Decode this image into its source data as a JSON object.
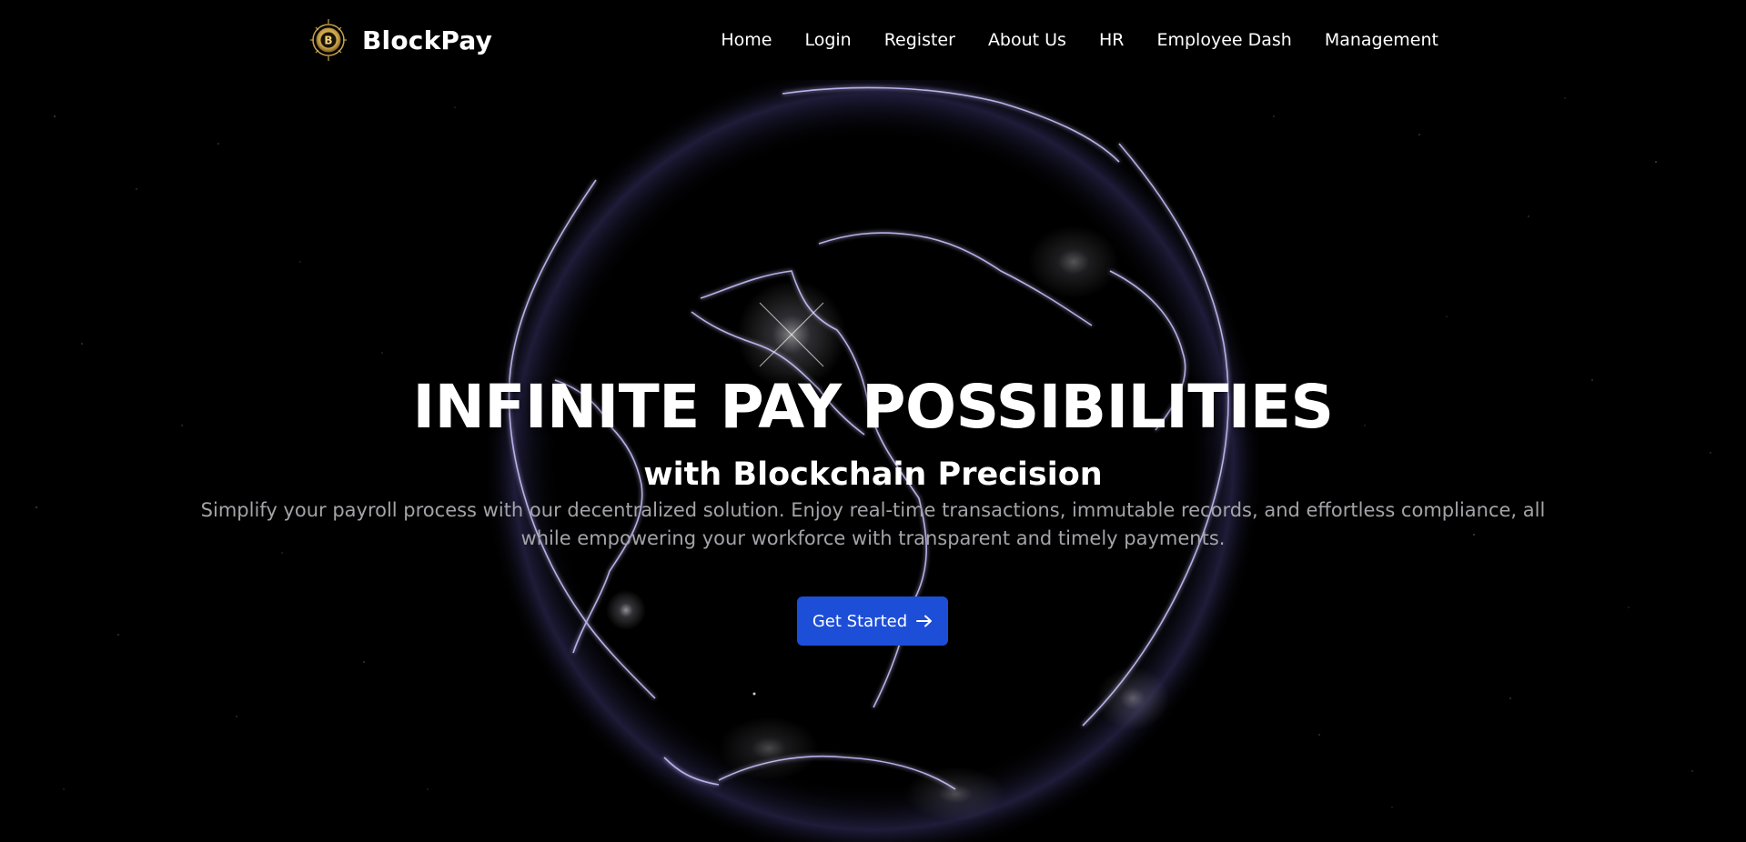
{
  "brand": {
    "name": "BlockPay",
    "logo_icon": "bitcoin-coin-icon",
    "logo_letter": "B",
    "logo_color": "#c9a24a"
  },
  "nav": {
    "items": [
      {
        "label": "Home"
      },
      {
        "label": "Login"
      },
      {
        "label": "Register"
      },
      {
        "label": "About Us"
      },
      {
        "label": "HR"
      },
      {
        "label": "Employee Dash"
      },
      {
        "label": "Management"
      }
    ]
  },
  "hero": {
    "title": "INFINITE PAY POSSIBILITIES",
    "subtitle": "with Blockchain Precision",
    "description": "Simplify your payroll process with our decentralized solution. Enjoy real-time transactions, immutable records, and effortless compliance, all while empowering your workforce with transparent and timely payments.",
    "cta_label": "Get Started",
    "cta_icon": "arrow-right-icon",
    "background_image": "glowing-earth-globe",
    "accent_color": "#1d4ed8"
  }
}
